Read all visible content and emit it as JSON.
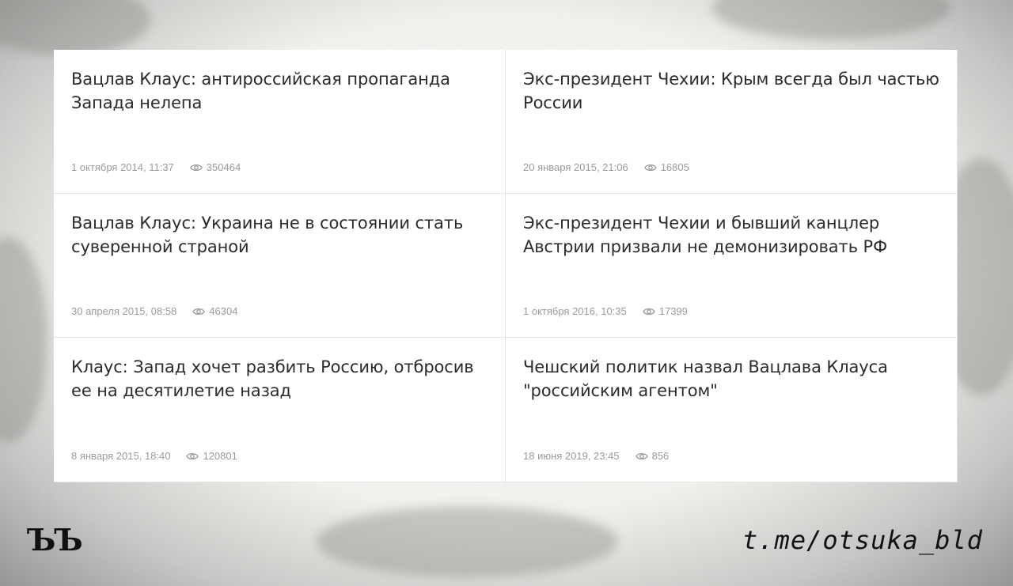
{
  "cards": [
    {
      "title": "Вацлав Клаус: антироссийская пропаганда Запада нелепа",
      "date": "1 октября 2014, 11:37",
      "views": "350464"
    },
    {
      "title": "Экс-президент Чехии: Крым всегда был частью России",
      "date": "20 января 2015, 21:06",
      "views": "16805"
    },
    {
      "title": "Вацлав Клаус: Украина не в состоянии стать суверенной страной",
      "date": "30 апреля 2015, 08:58",
      "views": "46304"
    },
    {
      "title": "Экс-президент Чехии и бывший канцлер Австрии призвали не демонизировать РФ",
      "date": "1 октября 2016, 10:35",
      "views": "17399"
    },
    {
      "title": "Клаус: Запад хочет разбить Россию, отбросив ее на десятилетие назад",
      "date": "8 января 2015, 18:40",
      "views": "120801"
    },
    {
      "title": "Чешский политик назвал Вацлава Клауса \"российским агентом\"",
      "date": "18 июня 2019, 23:45",
      "views": "856"
    }
  ],
  "footer": {
    "logo": "ЪЪ",
    "handle": "t.me/otsuka_bld"
  },
  "icons": {
    "views": "eye-icon"
  }
}
